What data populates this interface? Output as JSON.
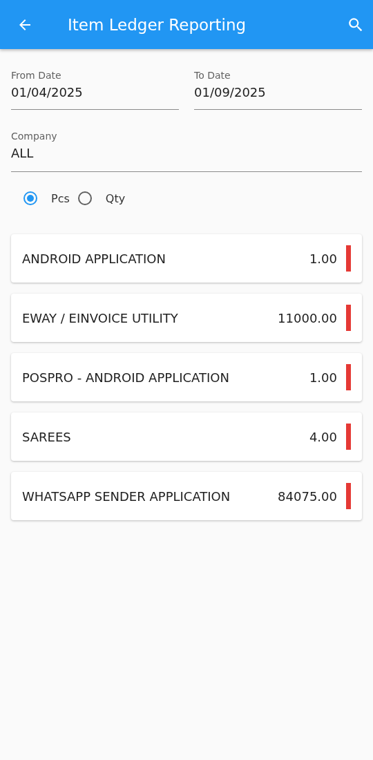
{
  "app_bar": {
    "title": "Item Ledger Reporting"
  },
  "fields": [
    {
      "label": "From Date",
      "value": "01/04/2025"
    },
    {
      "label": "To Date",
      "value": "01/09/2025"
    }
  ],
  "company": {
    "label": "Company",
    "value": "ALL"
  },
  "unit_options": [
    {
      "label": "Pcs",
      "selected": true
    },
    {
      "label": "Qty",
      "selected": false
    }
  ],
  "items": [
    {
      "name": "ANDROID APPLICATION",
      "amount": "1.00"
    },
    {
      "name": "EWAY / EINVOICE UTILITY",
      "amount": "11000.00"
    },
    {
      "name": "POSPRO - ANDROID APPLICATION",
      "amount": "1.00"
    },
    {
      "name": "SAREES",
      "amount": "4.00"
    },
    {
      "name": "WHATSAPP SENDER APPLICATION",
      "amount": "84075.00"
    }
  ]
}
